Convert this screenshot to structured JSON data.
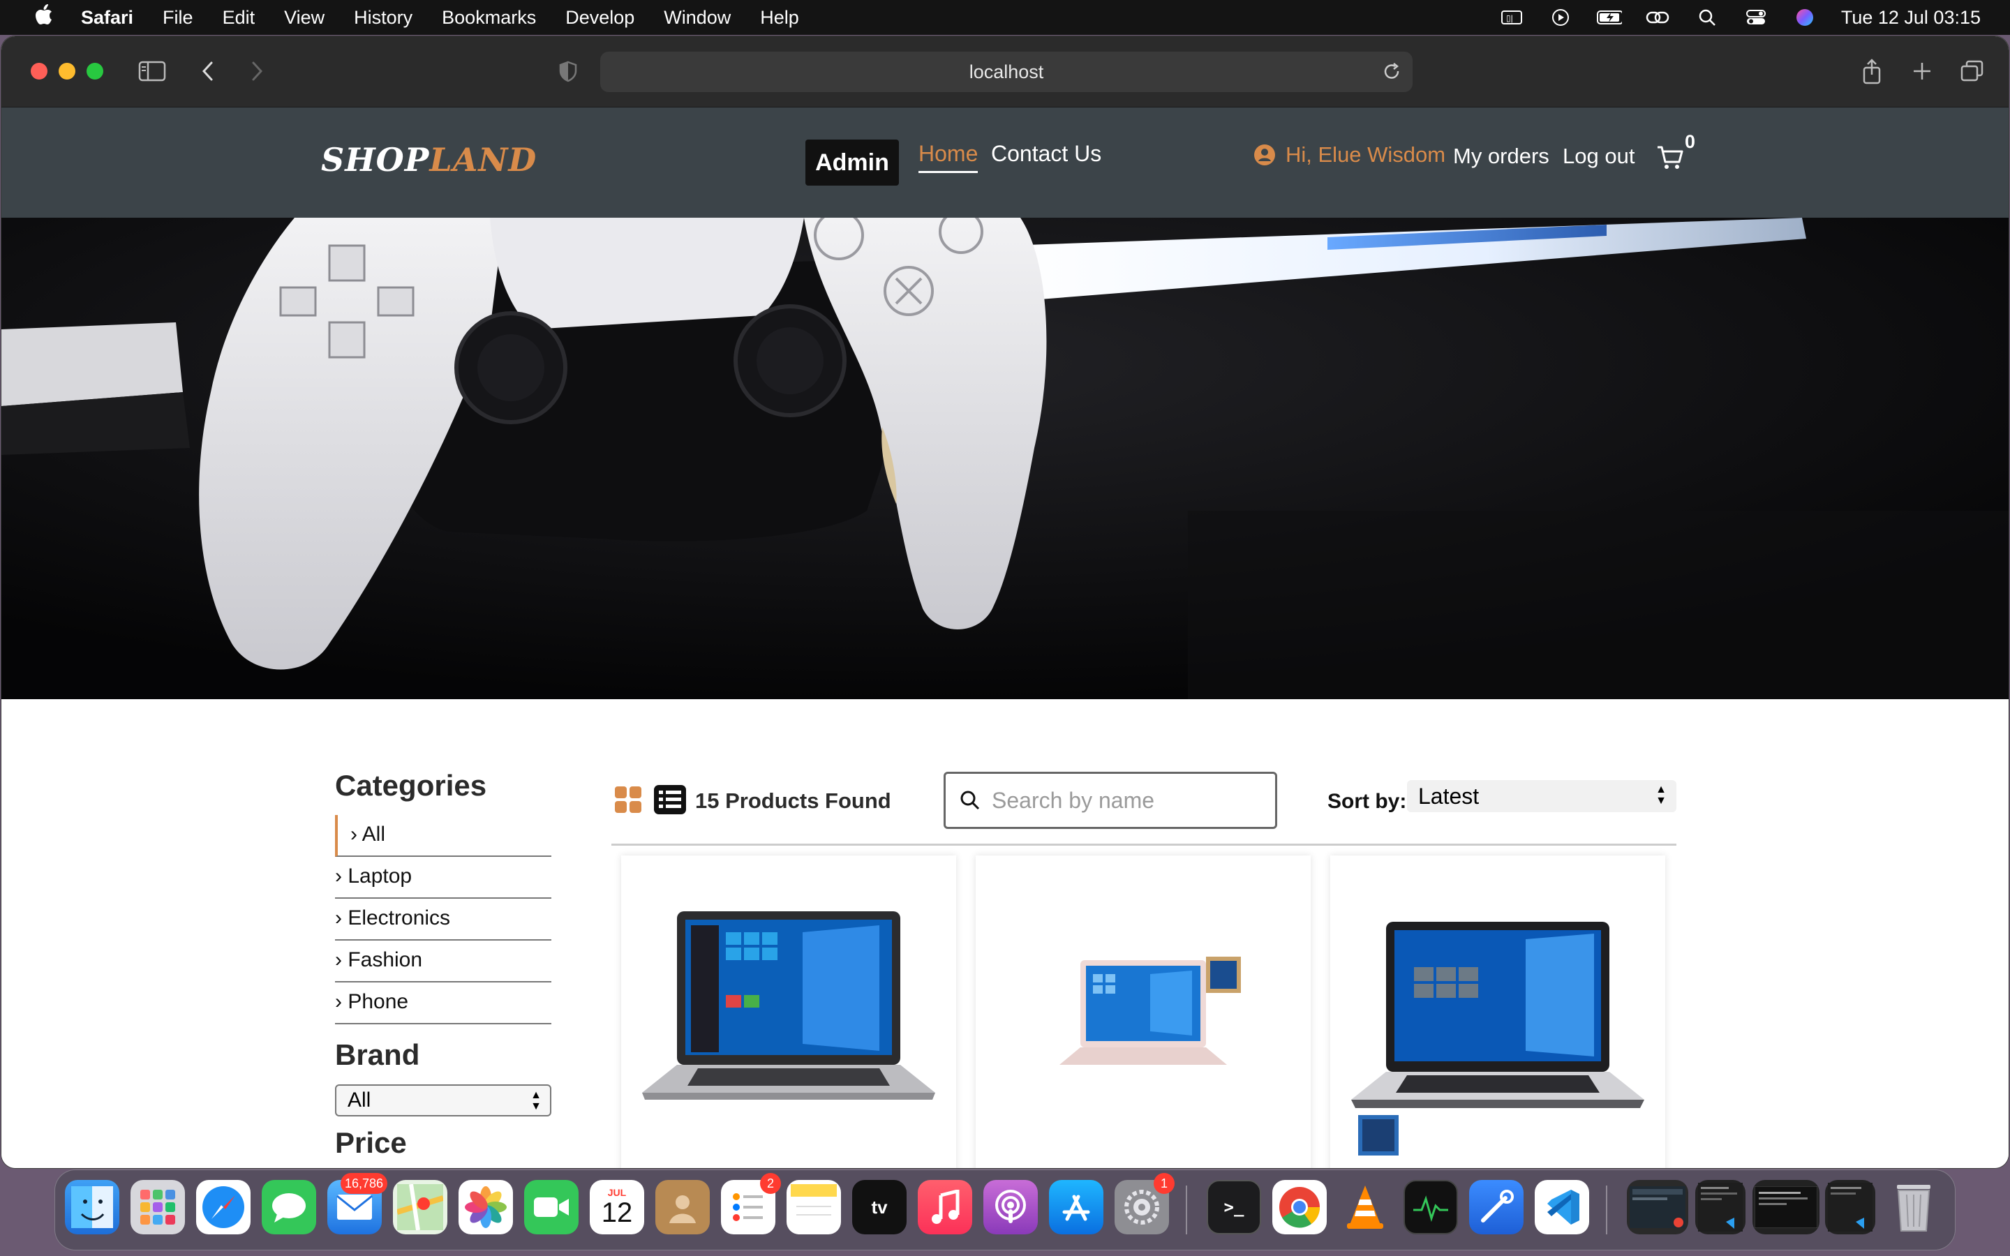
{
  "menubar": {
    "app": "Safari",
    "items": [
      "File",
      "Edit",
      "View",
      "History",
      "Bookmarks",
      "Develop",
      "Window",
      "Help"
    ],
    "clock": "Tue 12 Jul  03:15"
  },
  "browser": {
    "url": "localhost"
  },
  "site": {
    "logo_part1": "SHOP",
    "logo_part2": "LAND",
    "admin_label": "Admin",
    "nav_home": "Home",
    "nav_contact": "Contact Us",
    "greeting": "Hi, Elue Wisdom",
    "my_orders": "My orders",
    "logout": "Log out",
    "cart_count": "0"
  },
  "filters": {
    "categories_title": "Categories",
    "categories": [
      "› All",
      "› Laptop",
      "› Electronics",
      "› Fashion",
      "› Phone"
    ],
    "brand_title": "Brand",
    "brand_value": "All",
    "price_title": "Price"
  },
  "listing": {
    "found_text": "15 Products Found",
    "search_placeholder": "Search by name",
    "sort_label": "Sort by:",
    "sort_value": "Latest"
  },
  "dock": {
    "mail_badge": "16,786",
    "calendar_month": "JUL",
    "calendar_day": "12",
    "reminders_badge": "2",
    "settings_badge": "1",
    "tv_label": "tv"
  },
  "colors": {
    "accent": "#d98b4a",
    "header_bg": "#3c4449"
  }
}
